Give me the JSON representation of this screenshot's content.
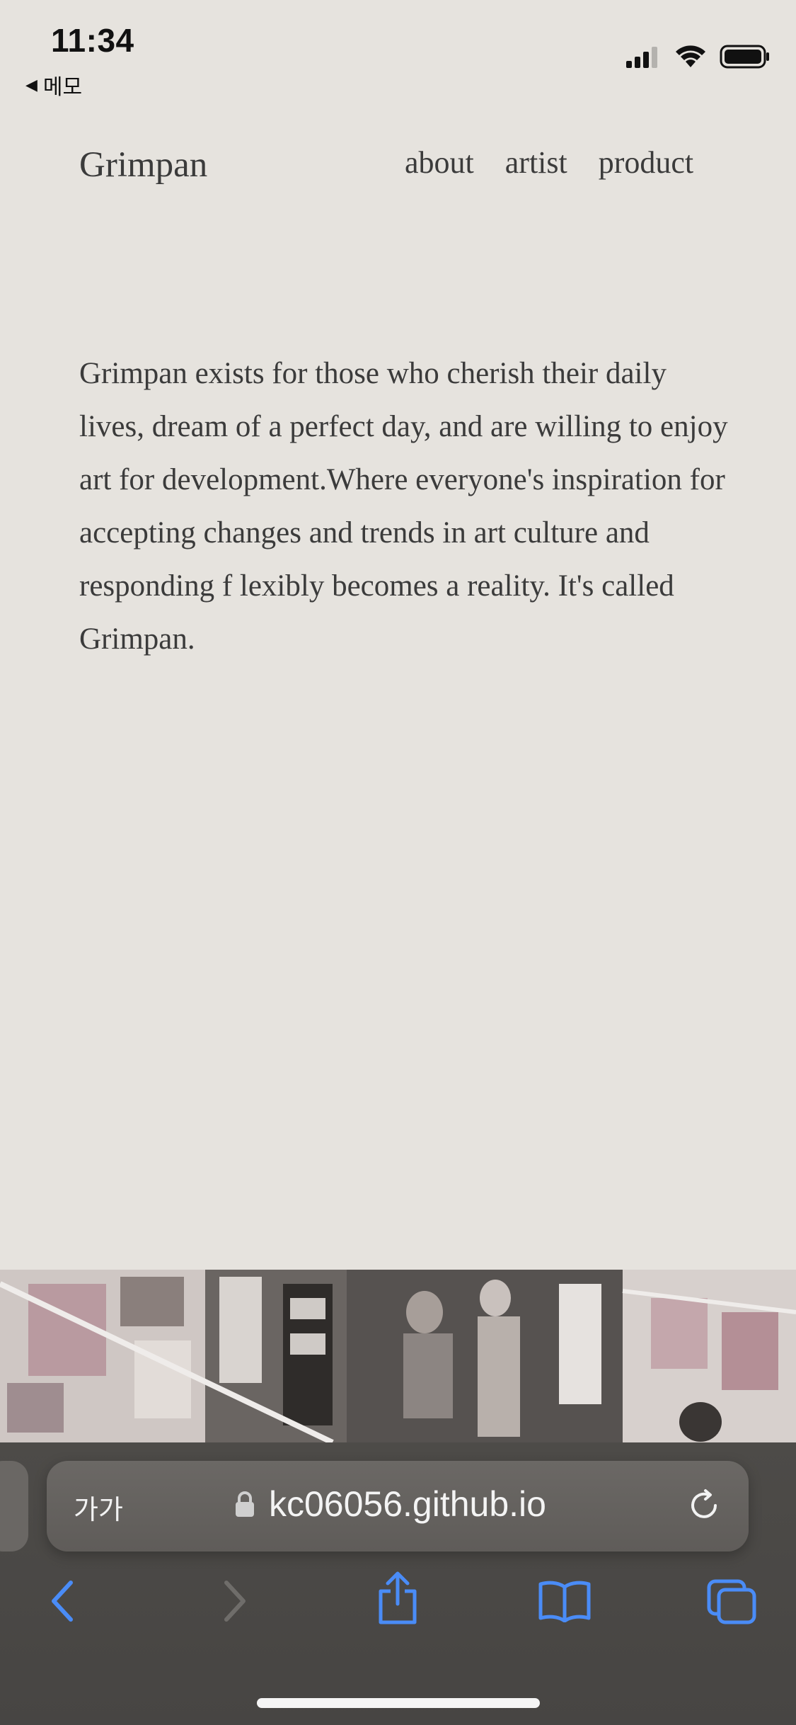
{
  "status_bar": {
    "time": "11:34",
    "back_label": "메모"
  },
  "site": {
    "logo": "Grimpan",
    "nav": [
      "about",
      "artist",
      "product"
    ],
    "intro_text": "Grimpan exists for those who cherish their daily lives, dream of a perfect day, and are willing to enjoy art for development.Where everyone's inspiration for accepting changes and trends in art culture and responding f lexibly becomes a reality. It's called Grimpan."
  },
  "browser": {
    "text_size_button": "가가",
    "url": "kc06056.github.io",
    "icons": {
      "back": "chevron-left-icon",
      "forward": "chevron-right-icon",
      "share": "share-icon",
      "bookmarks": "book-icon",
      "tabs": "tabs-icon",
      "reload": "reload-icon",
      "lock": "lock-icon"
    }
  },
  "colors": {
    "background": "#e6e3de",
    "text": "#3b3b3b",
    "browser_accent": "#4a8cf7",
    "chrome": "#4d4b48"
  }
}
